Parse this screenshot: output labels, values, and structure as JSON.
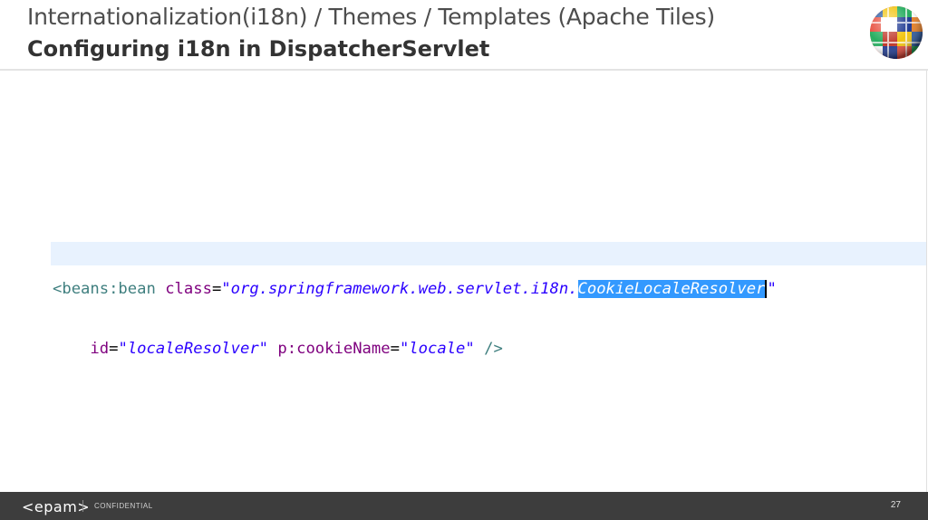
{
  "header": {
    "title": "Internationalization(i18n) / Themes / Templates (Apache Tiles)",
    "subtitle": "Configuring i18n in DispatcherServlet",
    "logo_icon": "globe-flags-icon"
  },
  "code": {
    "line1": {
      "tag": "<beans:bean",
      "attr": "class",
      "eq": "=",
      "value_prefix": "\"org.springframework.web.servlet.i18n.",
      "value_selected": "CookieLocaleResolver",
      "value_suffix": "\""
    },
    "line2": {
      "indent": "    ",
      "attr1": "id",
      "eq1": "=",
      "value1": "\"localeResolver\"",
      "attr2": "p:cookieName",
      "eq2": "=",
      "value2": "\"locale\"",
      "close": "/>"
    }
  },
  "footer": {
    "logo": "<epam>",
    "label": "CONFIDENTIAL",
    "page": "27"
  },
  "colors": {
    "footer_bg": "#3d3d3d",
    "selection": "#3399ff",
    "tag": "#3f7f7f",
    "attribute": "#7f007f",
    "string": "#2a00ff"
  }
}
